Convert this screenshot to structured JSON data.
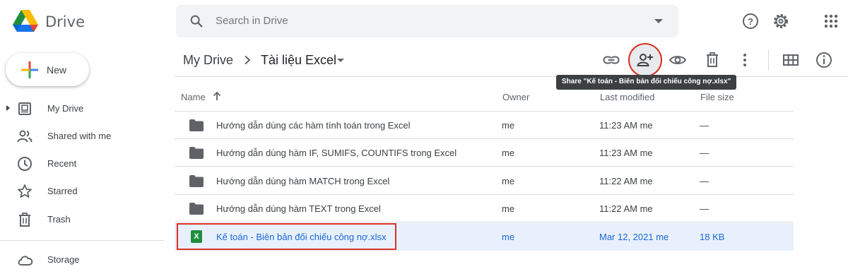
{
  "app": {
    "name": "Drive"
  },
  "search": {
    "placeholder": "Search in Drive"
  },
  "top_icons": [
    "help-icon",
    "settings-icon",
    "apps-grid-icon"
  ],
  "sidebar": {
    "new_label": "New",
    "items": [
      {
        "label": "My Drive",
        "icon": "my-drive-icon"
      },
      {
        "label": "Shared with me",
        "icon": "shared-icon"
      },
      {
        "label": "Recent",
        "icon": "clock-icon"
      },
      {
        "label": "Starred",
        "icon": "star-icon"
      },
      {
        "label": "Trash",
        "icon": "trash-icon"
      },
      {
        "label": "Storage",
        "icon": "cloud-icon"
      }
    ]
  },
  "breadcrumb": {
    "root": "My Drive",
    "current": "Tài liệu Excel"
  },
  "toolbar": {
    "icons": [
      "link-icon",
      "share-icon",
      "preview-icon",
      "trash-icon",
      "more-icon",
      "grid-view-icon",
      "info-icon"
    ],
    "tooltip": "Share \"Kế toán - Biên bản đối chiếu công nợ.xlsx\""
  },
  "table": {
    "headers": {
      "name": "Name",
      "owner": "Owner",
      "modified": "Last modified",
      "size": "File size"
    },
    "rows": [
      {
        "name": "Hướng dẫn dùng các hàm tính toán trong Excel",
        "owner": "me",
        "modified": "11:23 AM me",
        "size": "—",
        "type": "folder"
      },
      {
        "name": "Hướng dẫn dùng hàm IF, SUMIFS, COUNTIFS trong Excel",
        "owner": "me",
        "modified": "11:23 AM me",
        "size": "—",
        "type": "folder"
      },
      {
        "name": "Hướng dẫn dùng hàm MATCH trong Excel",
        "owner": "me",
        "modified": "11:22 AM me",
        "size": "—",
        "type": "folder"
      },
      {
        "name": "Hướng dẫn dùng hàm TEXT trong Excel",
        "owner": "me",
        "modified": "11:22 AM me",
        "size": "—",
        "type": "folder"
      },
      {
        "name": "Kế toán - Biên bản đối chiếu công nợ.xlsx",
        "owner": "me",
        "modified": "Mar 12, 2021  me",
        "size": "18 KB",
        "type": "excel",
        "selected": true
      }
    ]
  },
  "colors": {
    "accent": "#1967d2",
    "highlight": "#d93025",
    "selected_row": "#e8f0fe"
  }
}
